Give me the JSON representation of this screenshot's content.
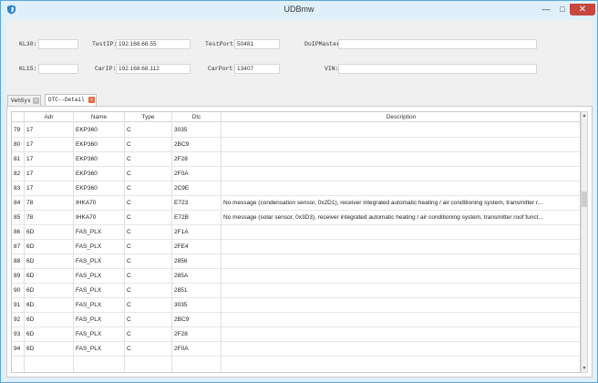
{
  "window": {
    "title": "UDBmw"
  },
  "fields": {
    "kl30_label": "KL30:",
    "kl15_label": "KL15:",
    "testip_label": "TestIP:",
    "testip_value": "192.168.68.55",
    "carip_label": "CarIP:",
    "carip_value": "192.168.68.112",
    "testport_label": "TestPort:",
    "testport_value": "50481",
    "carport_label": "CarPort:",
    "carport_value": "13407",
    "doip_label": "DoIPMaster:",
    "vin_label": "VIN:"
  },
  "tabs": [
    {
      "label": "VehSys",
      "close_color": "#bdbdbd"
    },
    {
      "label": "DTC--Detail",
      "close_color": "#e8663d"
    }
  ],
  "table": {
    "columns": [
      "",
      "Adr",
      "Name",
      "Type",
      "Dtc",
      "Description"
    ],
    "rows": [
      [
        "79",
        "17",
        "EKP360",
        "C",
        "3035",
        ""
      ],
      [
        "80",
        "17",
        "EKP360",
        "C",
        "2BC9",
        ""
      ],
      [
        "81",
        "17",
        "EKP360",
        "C",
        "2F28",
        ""
      ],
      [
        "82",
        "17",
        "EKP360",
        "C",
        "2F0A",
        ""
      ],
      [
        "83",
        "17",
        "EKP360",
        "C",
        "2C9E",
        ""
      ],
      [
        "84",
        "78",
        "IHKA70",
        "C",
        "E723",
        "No message (condensation sensor, 0x2D1), receiver integrated automatic heating / air conditioning system, transmitter r..."
      ],
      [
        "85",
        "78",
        "IHKA70",
        "C",
        "E72B",
        "No message (solar sensor, 0x3D3), receiver integrated automatic heating / air conditioning system, transmitter roof funct..."
      ],
      [
        "86",
        "6D",
        "FAS_PLX",
        "C",
        "2F1A",
        ""
      ],
      [
        "87",
        "6D",
        "FAS_PLX",
        "C",
        "2FE4",
        ""
      ],
      [
        "88",
        "6D",
        "FAS_PLX",
        "C",
        "2856",
        ""
      ],
      [
        "89",
        "6D",
        "FAS_PLX",
        "C",
        "285A",
        ""
      ],
      [
        "90",
        "6D",
        "FAS_PLX",
        "C",
        "2851",
        ""
      ],
      [
        "91",
        "6D",
        "FAS_PLX",
        "C",
        "3035",
        ""
      ],
      [
        "92",
        "6D",
        "FAS_PLX",
        "C",
        "2BC9",
        ""
      ],
      [
        "93",
        "6D",
        "FAS_PLX",
        "C",
        "2F28",
        ""
      ],
      [
        "94",
        "6D",
        "FAS_PLX",
        "C",
        "2F0A",
        ""
      ]
    ]
  },
  "scrollbar": {
    "up_arrow": "▲",
    "down_arrow": "▼"
  },
  "colors": {
    "window_border": "#5aa6dd",
    "close_button": "#c7473d",
    "app_icon": "#2f7fc9"
  }
}
